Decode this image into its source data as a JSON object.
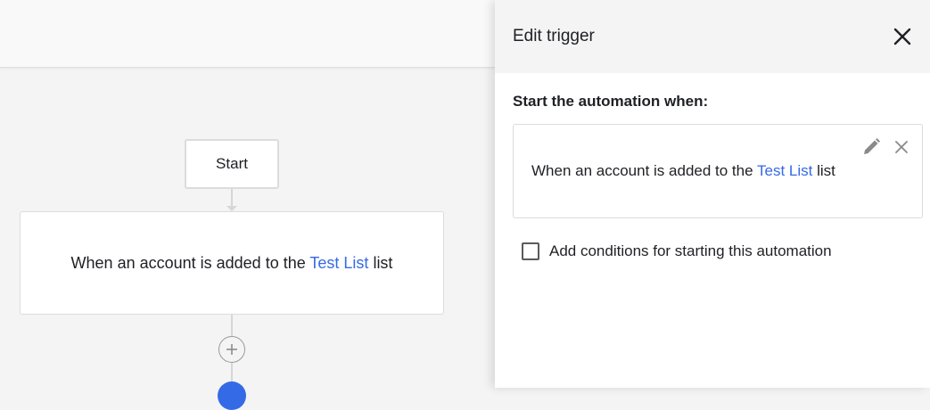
{
  "canvas": {
    "start_node_label": "Start",
    "trigger_card": {
      "text_before": "When an account is added to the ",
      "list_name": "Test List",
      "text_after": " list"
    }
  },
  "panel": {
    "title": "Edit trigger",
    "section_heading": "Start the automation when:",
    "trigger": {
      "text_before": "When an account is added to the ",
      "list_name": "Test List",
      "text_after": " list"
    },
    "conditions_checkbox": {
      "label": "Add conditions for starting this automation",
      "checked": false
    }
  },
  "icons": {
    "close": "close-icon",
    "edit": "pencil-icon",
    "remove": "x-icon",
    "add": "plus-circle-icon"
  },
  "colors": {
    "link": "#356ae6",
    "canvas_bg": "#f4f4f4",
    "panel_bg": "#ffffff"
  }
}
